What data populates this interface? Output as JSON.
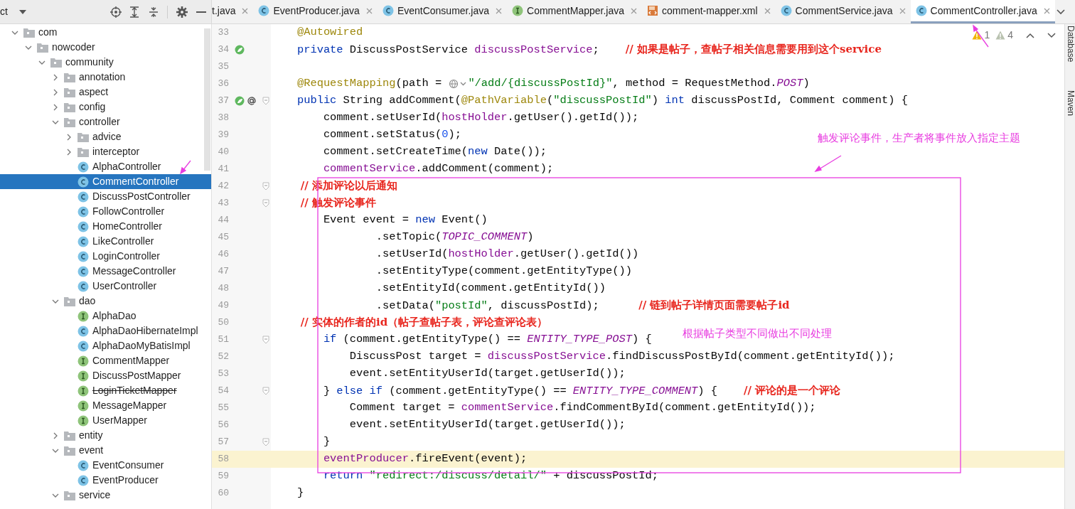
{
  "project_panel": {
    "title": "ct"
  },
  "tabs": [
    {
      "label": "t.java",
      "kind": "none",
      "selected": false
    },
    {
      "label": "EventProducer.java",
      "kind": "class",
      "selected": false
    },
    {
      "label": "EventConsumer.java",
      "kind": "class",
      "selected": false
    },
    {
      "label": "CommentMapper.java",
      "kind": "interface",
      "selected": false
    },
    {
      "label": "comment-mapper.xml",
      "kind": "xml",
      "selected": false
    },
    {
      "label": "CommentService.java",
      "kind": "class",
      "selected": false
    },
    {
      "label": "CommentController.java",
      "kind": "class",
      "selected": true
    }
  ],
  "tree": [
    {
      "label": "com",
      "kind": "folder",
      "expanded": true,
      "selected": false,
      "deprecated": false,
      "children": [
        {
          "label": "nowcoder",
          "kind": "folder",
          "expanded": true,
          "selected": false,
          "deprecated": false,
          "children": [
            {
              "label": "community",
              "kind": "folder",
              "expanded": true,
              "selected": false,
              "deprecated": false,
              "children": [
                {
                  "label": "annotation",
                  "kind": "folder",
                  "expanded": false,
                  "selected": false,
                  "deprecated": false
                },
                {
                  "label": "aspect",
                  "kind": "folder",
                  "expanded": false,
                  "selected": false,
                  "deprecated": false
                },
                {
                  "label": "config",
                  "kind": "folder",
                  "expanded": false,
                  "selected": false,
                  "deprecated": false
                },
                {
                  "label": "controller",
                  "kind": "folder",
                  "expanded": true,
                  "selected": false,
                  "deprecated": false,
                  "children": [
                    {
                      "label": "advice",
                      "kind": "folder",
                      "expanded": false,
                      "selected": false,
                      "deprecated": false
                    },
                    {
                      "label": "interceptor",
                      "kind": "folder",
                      "expanded": false,
                      "selected": false,
                      "deprecated": false
                    },
                    {
                      "label": "AlphaController",
                      "kind": "class",
                      "selected": false,
                      "deprecated": false
                    },
                    {
                      "label": "CommentController",
                      "kind": "class",
                      "selected": true,
                      "deprecated": false
                    },
                    {
                      "label": "DiscussPostController",
                      "kind": "class",
                      "selected": false,
                      "deprecated": false
                    },
                    {
                      "label": "FollowController",
                      "kind": "class",
                      "selected": false,
                      "deprecated": false
                    },
                    {
                      "label": "HomeController",
                      "kind": "class",
                      "selected": false,
                      "deprecated": false
                    },
                    {
                      "label": "LikeController",
                      "kind": "class",
                      "selected": false,
                      "deprecated": false
                    },
                    {
                      "label": "LoginController",
                      "kind": "class",
                      "selected": false,
                      "deprecated": false
                    },
                    {
                      "label": "MessageController",
                      "kind": "class",
                      "selected": false,
                      "deprecated": false
                    },
                    {
                      "label": "UserController",
                      "kind": "class",
                      "selected": false,
                      "deprecated": false
                    }
                  ]
                },
                {
                  "label": "dao",
                  "kind": "folder",
                  "expanded": true,
                  "selected": false,
                  "deprecated": false,
                  "children": [
                    {
                      "label": "AlphaDao",
                      "kind": "interface",
                      "selected": false,
                      "deprecated": false
                    },
                    {
                      "label": "AlphaDaoHibernateImpl",
                      "kind": "class",
                      "selected": false,
                      "deprecated": false
                    },
                    {
                      "label": "AlphaDaoMyBatisImpl",
                      "kind": "class",
                      "selected": false,
                      "deprecated": false
                    },
                    {
                      "label": "CommentMapper",
                      "kind": "interface",
                      "selected": false,
                      "deprecated": false
                    },
                    {
                      "label": "DiscussPostMapper",
                      "kind": "interface",
                      "selected": false,
                      "deprecated": false
                    },
                    {
                      "label": "LoginTicketMapper",
                      "kind": "interface",
                      "selected": false,
                      "deprecated": true
                    },
                    {
                      "label": "MessageMapper",
                      "kind": "interface",
                      "selected": false,
                      "deprecated": false
                    },
                    {
                      "label": "UserMapper",
                      "kind": "interface",
                      "selected": false,
                      "deprecated": false
                    }
                  ]
                },
                {
                  "label": "entity",
                  "kind": "folder",
                  "expanded": false,
                  "selected": false,
                  "deprecated": false
                },
                {
                  "label": "event",
                  "kind": "folder",
                  "expanded": true,
                  "selected": false,
                  "deprecated": false,
                  "children": [
                    {
                      "label": "EventConsumer",
                      "kind": "class",
                      "selected": false,
                      "deprecated": false
                    },
                    {
                      "label": "EventProducer",
                      "kind": "class",
                      "selected": false,
                      "deprecated": false
                    }
                  ]
                },
                {
                  "label": "service",
                  "kind": "folder",
                  "expanded": true,
                  "selected": false,
                  "deprecated": false
                }
              ]
            }
          ]
        }
      ]
    }
  ],
  "warnings": [
    {
      "kind": "warning",
      "count": "1"
    },
    {
      "kind": "weak",
      "count": "4"
    }
  ],
  "side_tools": [
    "Database",
    "Maven"
  ],
  "code": [
    {
      "number": "33",
      "kind": "plain",
      "current": false,
      "tokens": [
        {
          "kind": "annotation",
          "text": "    @Autowired"
        }
      ]
    },
    {
      "number": "34",
      "kind": "bean",
      "current": false,
      "tokens": [
        {
          "kind": "keyword",
          "text": "    private"
        },
        {
          "kind": "plain",
          "text": " DiscussPostService "
        },
        {
          "kind": "field",
          "text": "discussPostService"
        },
        {
          "kind": "plain",
          "text": ";    "
        },
        {
          "kind": "comment",
          "text": "// 如果是帖子，查帖子相关信息需要用到这个service"
        }
      ]
    },
    {
      "number": "35",
      "kind": "plain",
      "current": false
    },
    {
      "number": "36",
      "kind": "plain",
      "current": false,
      "tokens": [
        {
          "kind": "annotation",
          "text": "    @RequestMapping"
        },
        {
          "kind": "plain",
          "text": "(path = "
        },
        {
          "kind": "inlay"
        },
        {
          "kind": "string",
          "text": "\"/add/{discussPostId}\""
        },
        {
          "kind": "plain",
          "text": ", method = RequestMethod."
        },
        {
          "kind": "constant",
          "text": "POST"
        },
        {
          "kind": "plain",
          "text": ")"
        }
      ]
    },
    {
      "number": "37",
      "kind": "bean-at-fold",
      "current": false,
      "tokens": [
        {
          "kind": "keyword",
          "text": "    public"
        },
        {
          "kind": "plain",
          "text": " String addComment("
        },
        {
          "kind": "annotation",
          "text": "@PathVariable"
        },
        {
          "kind": "plain",
          "text": "("
        },
        {
          "kind": "string",
          "text": "\"discussPostId\""
        },
        {
          "kind": "plain",
          "text": ") "
        },
        {
          "kind": "keyword",
          "text": "int"
        },
        {
          "kind": "plain",
          "text": " discussPostId, Comment comment) {"
        }
      ]
    },
    {
      "number": "38",
      "kind": "plain",
      "current": false,
      "tokens": [
        {
          "kind": "plain",
          "text": "        comment.setUserId("
        },
        {
          "kind": "field",
          "text": "hostHolder"
        },
        {
          "kind": "plain",
          "text": ".getUser().getId());"
        }
      ]
    },
    {
      "number": "39",
      "kind": "plain",
      "current": false,
      "tokens": [
        {
          "kind": "plain",
          "text": "        comment.setStatus("
        },
        {
          "kind": "number",
          "text": "0"
        },
        {
          "kind": "plain",
          "text": ");"
        }
      ]
    },
    {
      "number": "40",
      "kind": "plain",
      "current": false,
      "tokens": [
        {
          "kind": "plain",
          "text": "        comment.setCreateTime("
        },
        {
          "kind": "keyword",
          "text": "new"
        },
        {
          "kind": "plain",
          "text": " Date());"
        }
      ]
    },
    {
      "number": "41",
      "kind": "plain",
      "current": false,
      "tokens": [
        {
          "kind": "field",
          "text": "        commentService"
        },
        {
          "kind": "plain",
          "text": ".addComment(comment);"
        }
      ]
    },
    {
      "number": "42",
      "kind": "fold",
      "current": false,
      "tokens": [
        {
          "kind": "comment",
          "text": "        // 添加评论以后通知"
        }
      ]
    },
    {
      "number": "43",
      "kind": "fold",
      "current": false,
      "tokens": [
        {
          "kind": "comment",
          "text": "        // 触发评论事件"
        }
      ]
    },
    {
      "number": "44",
      "kind": "plain",
      "current": false,
      "tokens": [
        {
          "kind": "plain",
          "text": "        Event event = "
        },
        {
          "kind": "keyword",
          "text": "new"
        },
        {
          "kind": "plain",
          "text": " Event()"
        }
      ]
    },
    {
      "number": "45",
      "kind": "plain",
      "current": false,
      "tokens": [
        {
          "kind": "plain",
          "text": "                .setTopic("
        },
        {
          "kind": "constant",
          "text": "TOPIC_COMMENT"
        },
        {
          "kind": "plain",
          "text": ")"
        }
      ]
    },
    {
      "number": "46",
      "kind": "plain",
      "current": false,
      "tokens": [
        {
          "kind": "plain",
          "text": "                .setUserId("
        },
        {
          "kind": "field",
          "text": "hostHolder"
        },
        {
          "kind": "plain",
          "text": ".getUser().getId())"
        }
      ]
    },
    {
      "number": "47",
      "kind": "plain",
      "current": false,
      "tokens": [
        {
          "kind": "plain",
          "text": "                .setEntityType(comment.getEntityType())"
        }
      ]
    },
    {
      "number": "48",
      "kind": "plain",
      "current": false,
      "tokens": [
        {
          "kind": "plain",
          "text": "                .setEntityId(comment.getEntityId())"
        }
      ]
    },
    {
      "number": "49",
      "kind": "plain",
      "current": false,
      "tokens": [
        {
          "kind": "plain",
          "text": "                .setData("
        },
        {
          "kind": "string",
          "text": "\"postId\""
        },
        {
          "kind": "plain",
          "text": ", discussPostId);      "
        },
        {
          "kind": "comment",
          "text": "// 链到帖子详情页面需要帖子id"
        }
      ]
    },
    {
      "number": "50",
      "kind": "plain",
      "current": false,
      "tokens": [
        {
          "kind": "comment",
          "text": "        // 实体的作者的id（帖子查帖子表，评论查评论表）"
        }
      ]
    },
    {
      "number": "51",
      "kind": "fold",
      "current": false,
      "tokens": [
        {
          "kind": "keyword",
          "text": "        if"
        },
        {
          "kind": "plain",
          "text": " (comment.getEntityType() == "
        },
        {
          "kind": "constant",
          "text": "ENTITY_TYPE_POST"
        },
        {
          "kind": "plain",
          "text": ") {"
        }
      ]
    },
    {
      "number": "52",
      "kind": "plain",
      "current": false,
      "tokens": [
        {
          "kind": "plain",
          "text": "            DiscussPost target = "
        },
        {
          "kind": "field",
          "text": "discussPostService"
        },
        {
          "kind": "plain",
          "text": ".findDiscussPostById(comment.getEntityId());"
        }
      ]
    },
    {
      "number": "53",
      "kind": "plain",
      "current": false,
      "tokens": [
        {
          "kind": "plain",
          "text": "            event.setEntityUserId(target.getUserId());"
        }
      ]
    },
    {
      "number": "54",
      "kind": "fold",
      "current": false,
      "tokens": [
        {
          "kind": "plain",
          "text": "        } "
        },
        {
          "kind": "keyword",
          "text": "else if"
        },
        {
          "kind": "plain",
          "text": " (comment.getEntityType() == "
        },
        {
          "kind": "constant",
          "text": "ENTITY_TYPE_COMMENT"
        },
        {
          "kind": "plain",
          "text": ") {    "
        },
        {
          "kind": "comment",
          "text": "// 评论的是一个评论"
        }
      ]
    },
    {
      "number": "55",
      "kind": "plain",
      "current": false,
      "tokens": [
        {
          "kind": "plain",
          "text": "            Comment target = "
        },
        {
          "kind": "field",
          "text": "commentService"
        },
        {
          "kind": "plain",
          "text": ".findCommentById(comment.getEntityId());"
        }
      ]
    },
    {
      "number": "56",
      "kind": "plain",
      "current": false,
      "tokens": [
        {
          "kind": "plain",
          "text": "            event.setEntityUserId(target.getUserId());"
        }
      ]
    },
    {
      "number": "57",
      "kind": "fold",
      "current": false,
      "tokens": [
        {
          "kind": "plain",
          "text": "        }"
        }
      ]
    },
    {
      "number": "58",
      "kind": "plain",
      "current": true,
      "tokens": [
        {
          "kind": "field",
          "text": "        eventProducer"
        },
        {
          "kind": "plain",
          "text": ".fireEvent(event);"
        }
      ]
    },
    {
      "number": "59",
      "kind": "plain",
      "current": false,
      "tokens": [
        {
          "kind": "keyword",
          "text": "        return"
        },
        {
          "kind": "string",
          "text": " \"redirect:/discuss/detail/\""
        },
        {
          "kind": "plain",
          "text": " + discussPostId;"
        }
      ]
    },
    {
      "number": "60",
      "kind": "plain",
      "current": false,
      "tokens": [
        {
          "kind": "plain",
          "text": "    }"
        }
      ]
    }
  ],
  "notes": [
    {
      "text": "触发评论事件，生产者将事件放入指定主题"
    },
    {
      "text": "根据帖子类型不同做出不同处理"
    }
  ]
}
